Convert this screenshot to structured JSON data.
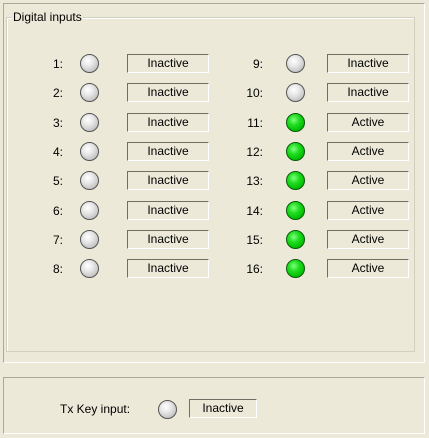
{
  "group_title": "Digital inputs",
  "colors": {
    "active": "#00c000",
    "inactive": "#c8c8c8",
    "background": "#ece9d8"
  },
  "inputs": [
    {
      "label": "1:",
      "status": "Inactive",
      "active": false
    },
    {
      "label": "2:",
      "status": "Inactive",
      "active": false
    },
    {
      "label": "3:",
      "status": "Inactive",
      "active": false
    },
    {
      "label": "4:",
      "status": "Inactive",
      "active": false
    },
    {
      "label": "5:",
      "status": "Inactive",
      "active": false
    },
    {
      "label": "6:",
      "status": "Inactive",
      "active": false
    },
    {
      "label": "7:",
      "status": "Inactive",
      "active": false
    },
    {
      "label": "8:",
      "status": "Inactive",
      "active": false
    },
    {
      "label": "9:",
      "status": "Inactive",
      "active": false
    },
    {
      "label": "10:",
      "status": "Inactive",
      "active": false
    },
    {
      "label": "11:",
      "status": "Active",
      "active": true
    },
    {
      "label": "12:",
      "status": "Active",
      "active": true
    },
    {
      "label": "13:",
      "status": "Active",
      "active": true
    },
    {
      "label": "14:",
      "status": "Active",
      "active": true
    },
    {
      "label": "15:",
      "status": "Active",
      "active": true
    },
    {
      "label": "16:",
      "status": "Active",
      "active": true
    }
  ],
  "tx_key": {
    "label": "Tx Key input:",
    "status": "Inactive",
    "active": false
  }
}
